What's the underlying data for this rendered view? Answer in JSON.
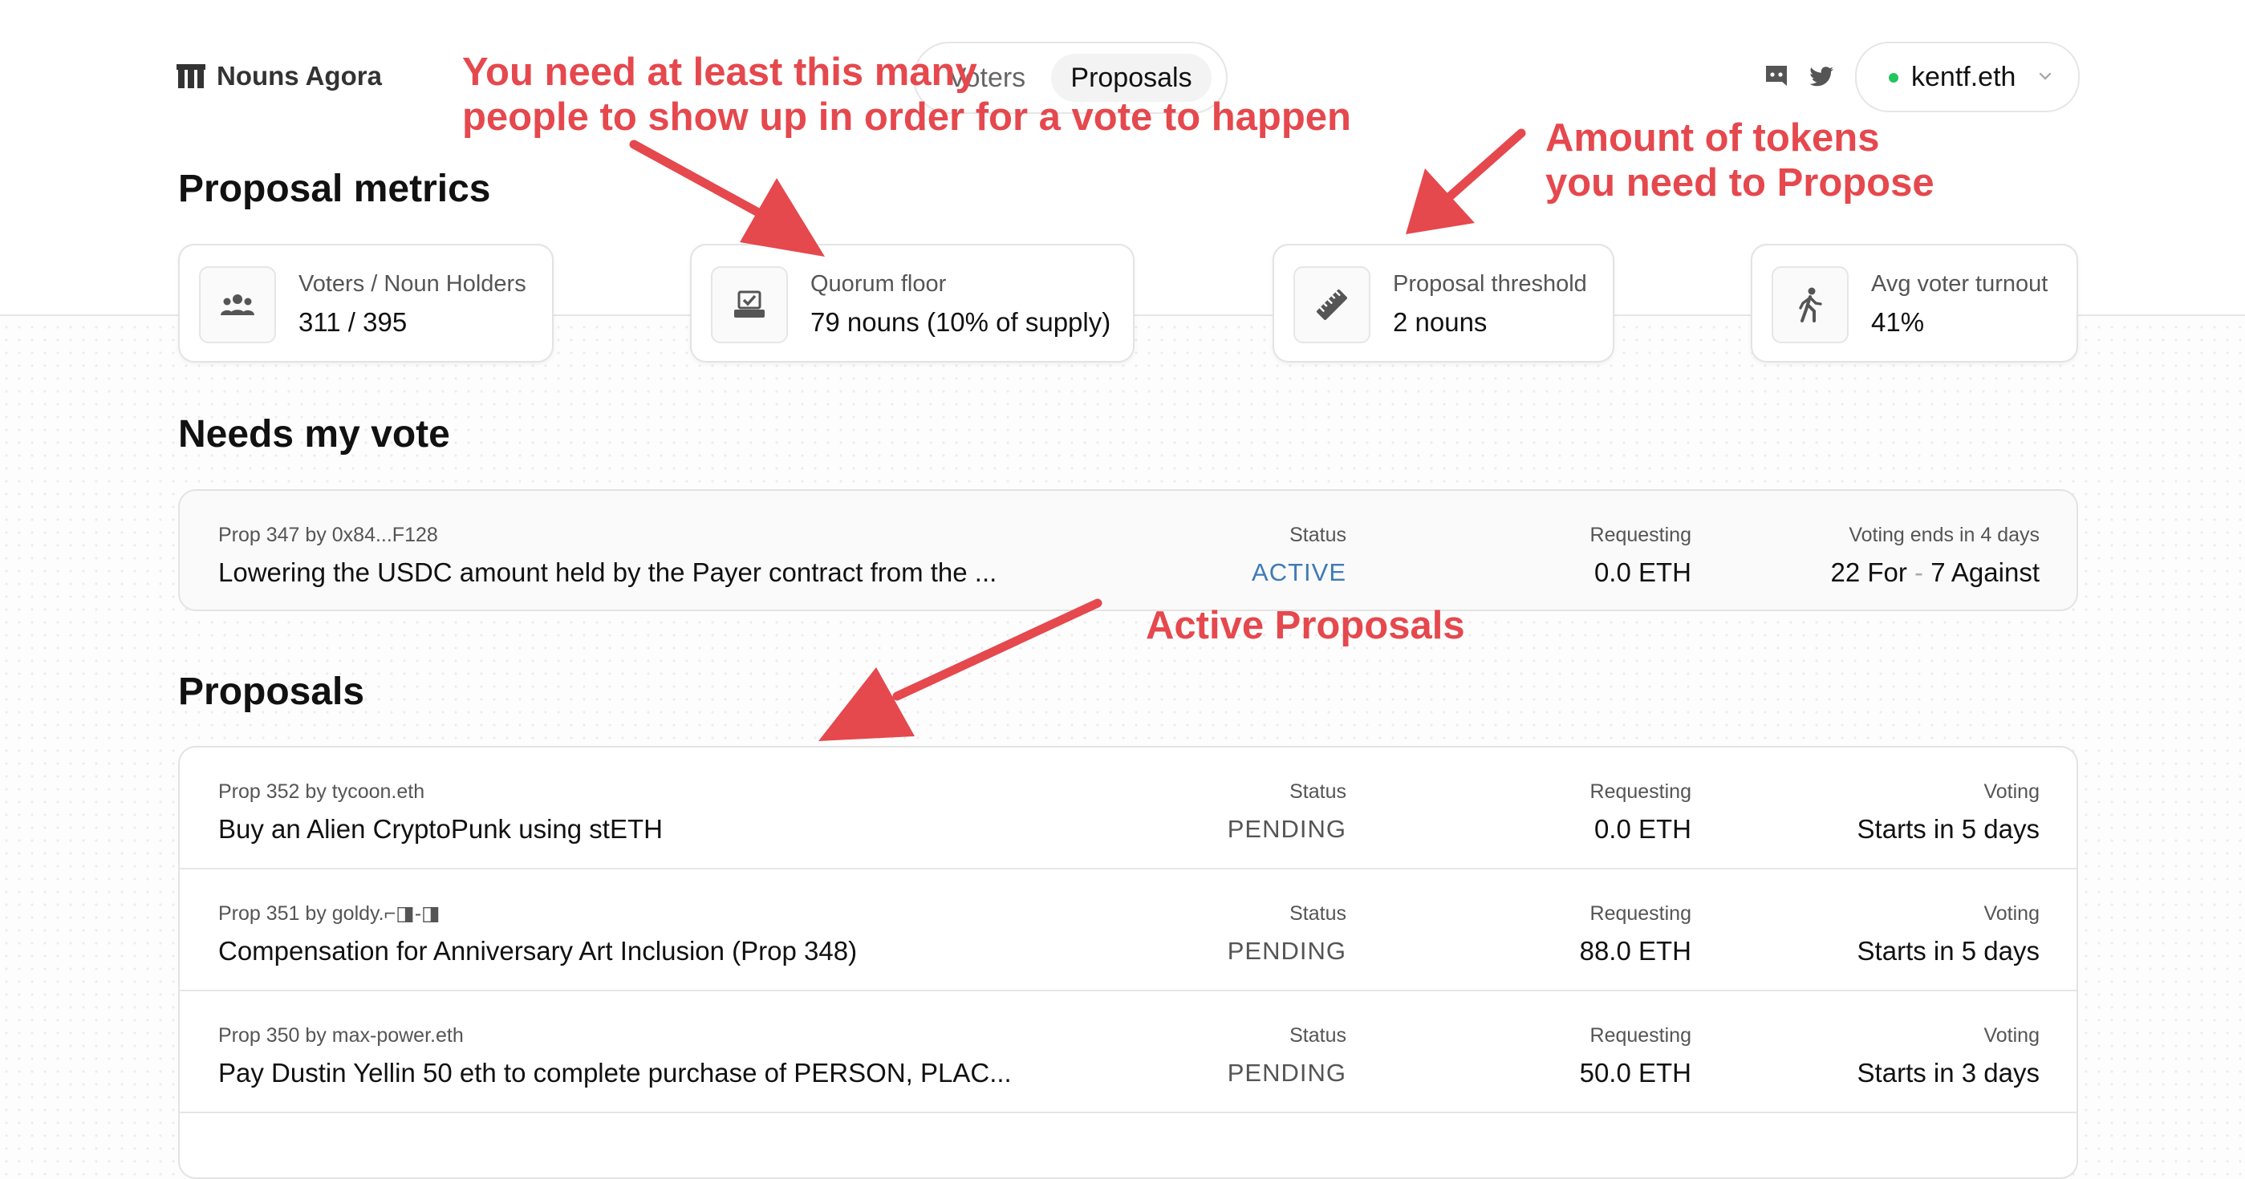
{
  "header": {
    "logo_text": "Nouns Agora",
    "nav": {
      "voters": "Voters",
      "proposals": "Proposals"
    },
    "wallet": {
      "name": "kentf.eth",
      "status_color": "#22c55e"
    },
    "icons": [
      "nouns-logo-icon",
      "discord-icon",
      "twitter-icon",
      "chevron-down-icon"
    ]
  },
  "metrics": {
    "title": "Proposal metrics",
    "items": [
      {
        "label": "Voters / Noun Holders",
        "value": "311 / 395",
        "icon": "users-icon"
      },
      {
        "label": "Quorum floor",
        "value": "79 nouns (10% of supply)",
        "icon": "ballot-box-icon"
      },
      {
        "label": "Proposal threshold",
        "value": "2 nouns",
        "icon": "ruler-icon"
      },
      {
        "label": "Avg voter turnout",
        "value": "41%",
        "icon": "walking-person-icon"
      }
    ]
  },
  "needs_vote": {
    "title": "Needs my vote",
    "rows": [
      {
        "sub": "Prop 347 by 0x84...F128",
        "title": "Lowering the USDC amount held by the Payer contract from the ...",
        "status_label": "Status",
        "status": "ACTIVE",
        "requesting_label": "Requesting",
        "requesting": "0.0 ETH",
        "voting_label": "Voting ends in 4 days",
        "votes_for": "22 For",
        "votes_sep": "-",
        "votes_against": "7 Against"
      }
    ]
  },
  "proposals": {
    "title": "Proposals",
    "rows": [
      {
        "sub": "Prop 352 by tycoon.eth",
        "title": "Buy an Alien CryptoPunk using stETH",
        "status_label": "Status",
        "status": "PENDING",
        "requesting_label": "Requesting",
        "requesting": "0.0 ETH",
        "voting_label": "Voting",
        "voting": "Starts in 5 days"
      },
      {
        "sub": "Prop 351 by goldy.⌐◨-◨",
        "title": "Compensation for Anniversary Art Inclusion (Prop 348)",
        "status_label": "Status",
        "status": "PENDING",
        "requesting_label": "Requesting",
        "requesting": "88.0 ETH",
        "voting_label": "Voting",
        "voting": "Starts in 5 days"
      },
      {
        "sub": "Prop 350 by max-power.eth",
        "title": "Pay Dustin Yellin 50 eth to complete purchase of PERSON, PLAC...",
        "status_label": "Status",
        "status": "PENDING",
        "requesting_label": "Requesting",
        "requesting": "50.0 ETH",
        "voting_label": "Voting",
        "voting": "Starts in 3 days"
      }
    ]
  },
  "annotations": {
    "quorum": [
      "You need at least this many",
      "people to show up in order for a vote to happen"
    ],
    "threshold": [
      "Amount of tokens",
      "you need to Propose"
    ],
    "active": "Active Proposals",
    "color": "#e5484d"
  },
  "colors": {
    "active_status": "#3d7ab8",
    "pending_status": "#555555"
  }
}
